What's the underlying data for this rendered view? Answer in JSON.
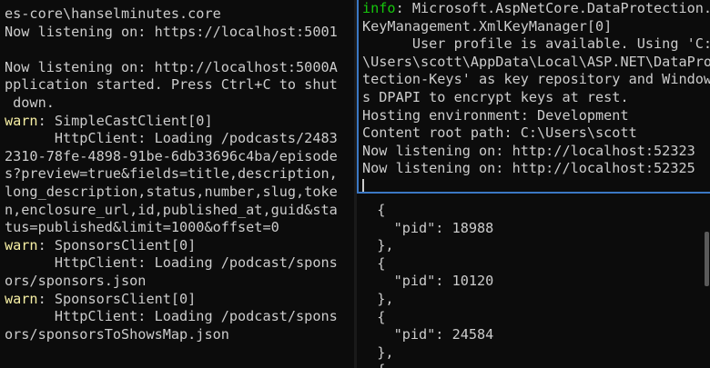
{
  "left_pane": {
    "lines": [
      {
        "text": "es-core\\hanselminutes.core",
        "style": "plain"
      },
      {
        "text": "Now listening on: https://localhost:5001",
        "style": "plain"
      },
      {
        "text": "",
        "style": "plain"
      },
      {
        "text": "Now listening on: http://localhost:5000A",
        "style": "plain"
      },
      {
        "text": "pplication started. Press Ctrl+C to shut",
        "style": "plain"
      },
      {
        "text": " down.",
        "style": "plain"
      },
      {
        "prefix": "warn",
        "text": ": SimpleCastClient[0]",
        "style": "warn"
      },
      {
        "text": "      HttpClient: Loading /podcasts/2483",
        "style": "plain"
      },
      {
        "text": "2310-78fe-4898-91be-6db33696c4ba/episode",
        "style": "plain"
      },
      {
        "text": "s?preview=true&fields=title,description,",
        "style": "plain"
      },
      {
        "text": "long_description,status,number,slug,toke",
        "style": "plain"
      },
      {
        "text": "n,enclosure_url,id,published_at,guid&sta",
        "style": "plain"
      },
      {
        "text": "tus=published&limit=1000&offset=0",
        "style": "plain"
      },
      {
        "prefix": "warn",
        "text": ": SponsorsClient[0]",
        "style": "warn"
      },
      {
        "text": "      HttpClient: Loading /podcast/spons",
        "style": "plain"
      },
      {
        "text": "ors/sponsors.json",
        "style": "plain"
      },
      {
        "prefix": "warn",
        "text": ": SponsorsClient[0]",
        "style": "warn"
      },
      {
        "text": "      HttpClient: Loading /podcast/spons",
        "style": "plain"
      },
      {
        "text": "ors/sponsorsToShowsMap.json",
        "style": "plain"
      }
    ]
  },
  "right_top_pane": {
    "lines": [
      {
        "prefix": "info",
        "text": ": Microsoft.AspNetCore.DataProtection.",
        "style": "info"
      },
      {
        "text": "KeyManagement.XmlKeyManager[0]",
        "style": "plain"
      },
      {
        "text": "      User profile is available. Using 'C:",
        "style": "plain"
      },
      {
        "text": "\\Users\\scott\\AppData\\Local\\ASP.NET\\DataPro",
        "style": "plain"
      },
      {
        "text": "tection-Keys' as key repository and Window",
        "style": "plain"
      },
      {
        "text": "s DPAPI to encrypt keys at rest.",
        "style": "plain"
      },
      {
        "text": "Hosting environment: Development",
        "style": "plain"
      },
      {
        "text": "Content root path: C:\\Users\\scott",
        "style": "plain"
      },
      {
        "text": "Now listening on: http://localhost:52323",
        "style": "plain"
      },
      {
        "text": "Now listening on: http://localhost:52325",
        "style": "plain"
      }
    ]
  },
  "right_bottom_pane": {
    "lines": [
      {
        "text": "  {",
        "style": "plain"
      },
      {
        "text": "    \"pid\": 18988",
        "style": "plain"
      },
      {
        "text": "  },",
        "style": "plain"
      },
      {
        "text": "  {",
        "style": "plain"
      },
      {
        "text": "    \"pid\": 10120",
        "style": "plain"
      },
      {
        "text": "  },",
        "style": "plain"
      },
      {
        "text": "  {",
        "style": "plain"
      },
      {
        "text": "    \"pid\": 24584",
        "style": "plain"
      },
      {
        "text": "  },",
        "style": "plain"
      },
      {
        "text": "  {",
        "style": "plain"
      }
    ]
  },
  "colors": {
    "background": "#0c0c0c",
    "foreground": "#cccccc",
    "warn": "#f9f1a5",
    "info": "#16c60c",
    "active_pane_border": "#3b78c4"
  }
}
